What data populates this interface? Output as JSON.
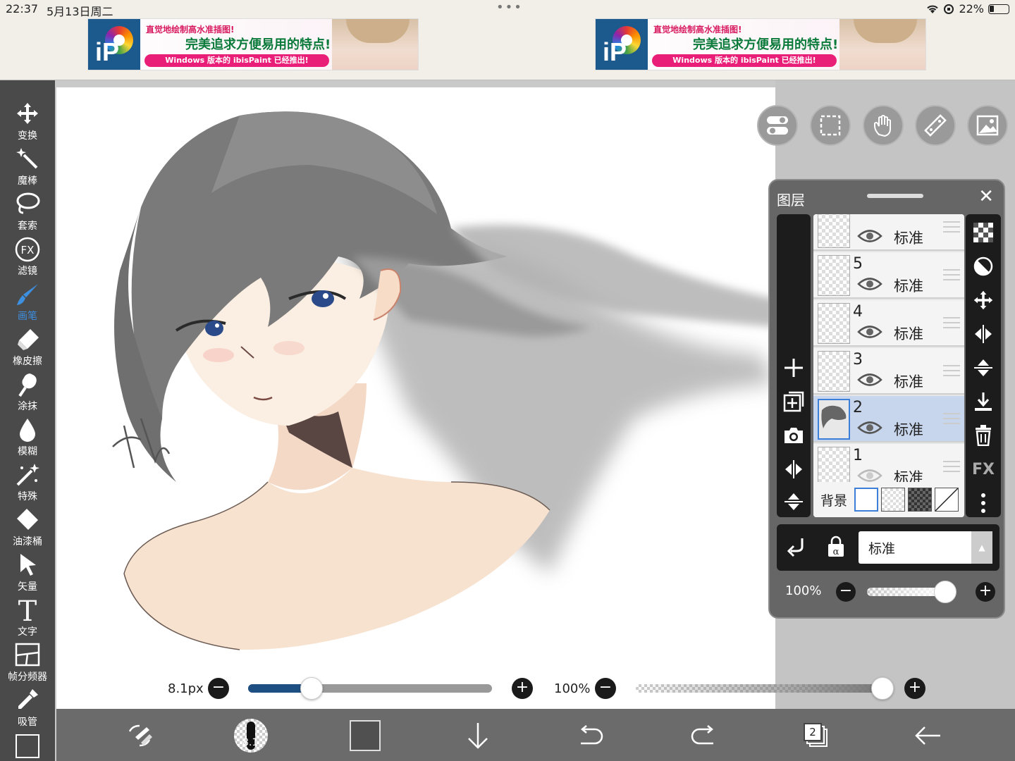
{
  "status": {
    "time": "22:37",
    "date": "5月13日周二",
    "dots": "•••",
    "battery": "22%"
  },
  "ads": [
    {
      "line1": "直觉地绘制高水准插图!",
      "line2": "完美追求方便易用的特点!",
      "line3": "Windows 版本的 ibisPaint 已经推出!",
      "logo": "iP"
    },
    {
      "line1": "直觉地绘制高水准插图!",
      "line2": "完美追求方便易用的特点!",
      "line3": "Windows 版本的 ibisPaint 已经推出!",
      "logo": "iP"
    }
  ],
  "tools": [
    {
      "label": "变换",
      "icon": "move-icon"
    },
    {
      "label": "魔棒",
      "icon": "magic-wand-icon"
    },
    {
      "label": "套索",
      "icon": "lasso-icon"
    },
    {
      "label": "滤镜",
      "icon": "fx-icon",
      "glyph": "FX"
    },
    {
      "label": "画笔",
      "icon": "brush-icon",
      "active": true
    },
    {
      "label": "橡皮擦",
      "icon": "eraser-icon"
    },
    {
      "label": "涂抹",
      "icon": "smudge-icon"
    },
    {
      "label": "模糊",
      "icon": "blur-drop-icon"
    },
    {
      "label": "特殊",
      "icon": "special-sparkle-icon"
    },
    {
      "label": "油漆桶",
      "icon": "paint-bucket-icon"
    },
    {
      "label": "矢量",
      "icon": "vector-arrow-icon"
    },
    {
      "label": "文字",
      "icon": "text-icon",
      "glyph": "T"
    },
    {
      "label": "帧分频器",
      "icon": "frame-divider-icon"
    },
    {
      "label": "吸管",
      "icon": "eyedropper-icon"
    }
  ],
  "canvas_buttons": [
    "toggle-icon",
    "selection-icon",
    "hand-icon",
    "ruler-icon",
    "image-icon"
  ],
  "layer_panel": {
    "title": "图层",
    "layers": [
      {
        "number": "",
        "mode": "标准",
        "visible": true,
        "selected": false
      },
      {
        "number": "5",
        "mode": "标准",
        "visible": true,
        "selected": false
      },
      {
        "number": "4",
        "mode": "标准",
        "visible": true,
        "selected": false
      },
      {
        "number": "3",
        "mode": "标准",
        "visible": true,
        "selected": false
      },
      {
        "number": "2",
        "mode": "标准",
        "visible": true,
        "selected": true
      },
      {
        "number": "1",
        "mode": "标准",
        "visible": false,
        "selected": false
      }
    ],
    "background_label": "背景",
    "blend_mode": "标准",
    "opacity_label": "100%",
    "opacity_level": 0.96,
    "fx_label": "FX"
  },
  "brush": {
    "size_label": "8.1px",
    "size_level": 0.26,
    "opacity_label": "100%",
    "opacity_level": 1.0
  },
  "bottom_bar": {
    "brush_size_badge": "8.1",
    "layer_count": "2",
    "color": "#505050"
  }
}
